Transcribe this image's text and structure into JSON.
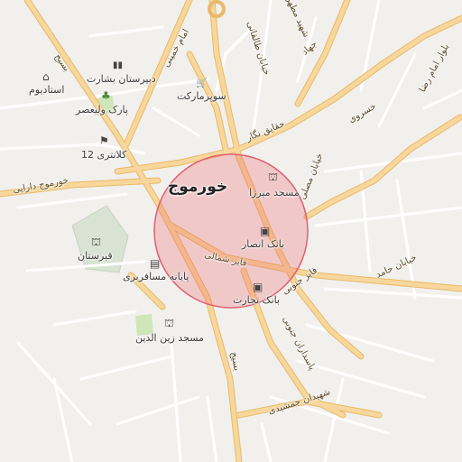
{
  "colors": {
    "background": "#f2f0ed",
    "main_road": "#f7d79b",
    "main_road_edge": "#e8b96a",
    "minor_road": "#ffffff",
    "minor_road_edge": "#d8d4cf",
    "park": "#cfe6b8",
    "cemetery": "#d9e3d3",
    "highlight_fill": "rgba(236,98,104,0.28)",
    "highlight_stroke": "#e06070"
  },
  "city": {
    "name": "خورموج"
  },
  "roads": {
    "basij_north": "بسیج",
    "basij_south": "بسیج",
    "imam_khomeini": "امام خمینی",
    "taleghani": "خیابان طالقانی",
    "jahad": "جهاد",
    "shahid_motahari": "شهید مطهری",
    "imam_reza": "بلوار امام رضا",
    "haghayegh_negar": "حقایق نگار",
    "khosravi": "خسروی",
    "moslehi": "خیابان مصلی",
    "khormuj_darai": "خورموج دارایی",
    "hamed": "خیابان حامد",
    "faez_shomali": "فایز شمالی",
    "faez_jonubi": "فایز جنوبی",
    "pasdaran_jonubi": "پاسداران جنوبی",
    "shohada_jamshidi": "شهیدان جمشیدی"
  },
  "pois": [
    {
      "name": "استادیوم",
      "icon": "stadium-icon",
      "glyph": "⌂"
    },
    {
      "name": "دبیرستان بشارت",
      "icon": "school-icon",
      "glyph": "▮▮"
    },
    {
      "name": "پارک ولیعصر",
      "icon": "park-icon",
      "glyph": "♣"
    },
    {
      "name": "کلانتری 12",
      "icon": "police-icon",
      "glyph": "⚑"
    },
    {
      "name": "سوپرمارکت",
      "icon": "cart-icon",
      "glyph": "🛒"
    },
    {
      "name": "مسجد میرزا",
      "icon": "mosque-icon",
      "glyph": "⛫"
    },
    {
      "name": "بانک انصار",
      "icon": "bank-icon",
      "glyph": "▣"
    },
    {
      "name": "بانک تجارت",
      "icon": "bank-icon",
      "glyph": "▣"
    },
    {
      "name": "پایانه مسافربری",
      "icon": "bus-icon",
      "glyph": "▤"
    },
    {
      "name": "قبرستان",
      "icon": "cemetery-icon",
      "glyph": "⛫"
    },
    {
      "name": "مسجد زین الدین",
      "icon": "mosque-icon",
      "glyph": "⛫"
    }
  ]
}
